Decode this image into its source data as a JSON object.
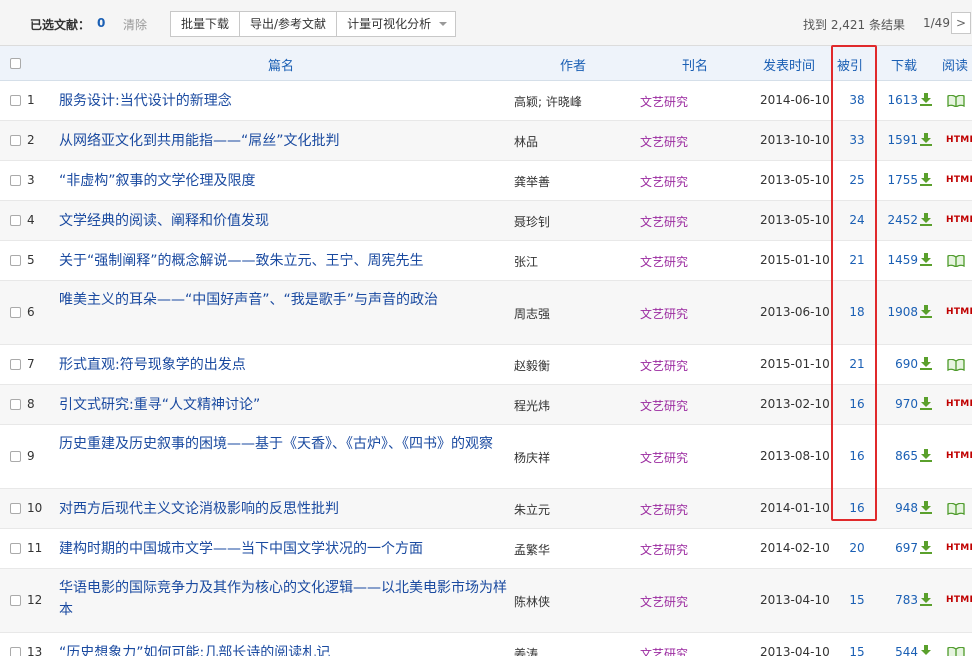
{
  "toolbar": {
    "selected_label": "已选文献：",
    "selected_count": "0",
    "clear": "清除",
    "batch_download": "批量下载",
    "export": "导出/参考文献",
    "analysis": "计量可视化分析",
    "result_count": "找到 2,421 条结果",
    "page": "1/49",
    "next": ">"
  },
  "columns": {
    "title": "篇名",
    "author": "作者",
    "journal": "刊名",
    "date": "发表时间",
    "cited": "被引",
    "download": "下载",
    "read": "阅读"
  },
  "rows": [
    {
      "num": "1",
      "title": "服务设计:当代设计的新理念",
      "author": "高颖; 许晓峰",
      "journal": "文艺研究",
      "date": "2014-06-10",
      "cited": "38",
      "downloads": "1613",
      "read": "book"
    },
    {
      "num": "2",
      "title": "从网络亚文化到共用能指——“屌丝”文化批判",
      "author": "林品",
      "journal": "文艺研究",
      "date": "2013-10-10",
      "cited": "33",
      "downloads": "1591",
      "read": "HTML"
    },
    {
      "num": "3",
      "title": "“非虚构”叙事的文学伦理及限度",
      "author": "龚举善",
      "journal": "文艺研究",
      "date": "2013-05-10",
      "cited": "25",
      "downloads": "1755",
      "read": "HTML"
    },
    {
      "num": "4",
      "title": "文学经典的阅读、阐释和价值发现",
      "author": "聂珍钊",
      "journal": "文艺研究",
      "date": "2013-05-10",
      "cited": "24",
      "downloads": "2452",
      "read": "HTML"
    },
    {
      "num": "5",
      "title": "关于“强制阐释”的概念解说——致朱立元、王宁、周宪先生",
      "author": "张江",
      "journal": "文艺研究",
      "date": "2015-01-10",
      "cited": "21",
      "downloads": "1459",
      "read": "book"
    },
    {
      "num": "6",
      "title": "唯美主义的耳朵——“中国好声音”、“我是歌手”与声音的政治",
      "author": "周志强",
      "journal": "文艺研究",
      "date": "2013-06-10",
      "cited": "18",
      "downloads": "1908",
      "read": "HTML"
    },
    {
      "num": "7",
      "title": "形式直观:符号现象学的出发点",
      "author": "赵毅衡",
      "journal": "文艺研究",
      "date": "2015-01-10",
      "cited": "21",
      "downloads": "690",
      "read": "book"
    },
    {
      "num": "8",
      "title": "引文式研究:重寻“人文精神讨论”",
      "author": "程光炜",
      "journal": "文艺研究",
      "date": "2013-02-10",
      "cited": "16",
      "downloads": "970",
      "read": "HTML"
    },
    {
      "num": "9",
      "title": "历史重建及历史叙事的困境——基于《天香》、《古炉》、《四书》的观察",
      "author": "杨庆祥",
      "journal": "文艺研究",
      "date": "2013-08-10",
      "cited": "16",
      "downloads": "865",
      "read": "HTML"
    },
    {
      "num": "10",
      "title": "对西方后现代主义文论消极影响的反思性批判",
      "author": "朱立元",
      "journal": "文艺研究",
      "date": "2014-01-10",
      "cited": "16",
      "downloads": "948",
      "read": "book"
    },
    {
      "num": "11",
      "title": "建构时期的中国城市文学——当下中国文学状况的一个方面",
      "author": "孟繁华",
      "journal": "文艺研究",
      "date": "2014-02-10",
      "cited": "20",
      "downloads": "697",
      "read": "HTML"
    },
    {
      "num": "12",
      "title": "华语电影的国际竞争力及其作为核心的文化逻辑——以北美电影市场为样本",
      "author": "陈林侠",
      "journal": "文艺研究",
      "date": "2013-04-10",
      "cited": "15",
      "downloads": "783",
      "read": "HTML"
    },
    {
      "num": "13",
      "title": "“历史想象力”如何可能:几部长诗的阅读札记",
      "author": "姜涛",
      "journal": "文艺研究",
      "date": "2013-04-10",
      "cited": "15",
      "downloads": "544",
      "read": "book"
    }
  ],
  "colors": {
    "header_text": "#1a5fb4",
    "title_link": "#1a4aa0",
    "journal": "#9b2ba0",
    "highlight_box": "#e0292b",
    "download_icon": "#5aa02c",
    "html_badge": "#c00000"
  }
}
